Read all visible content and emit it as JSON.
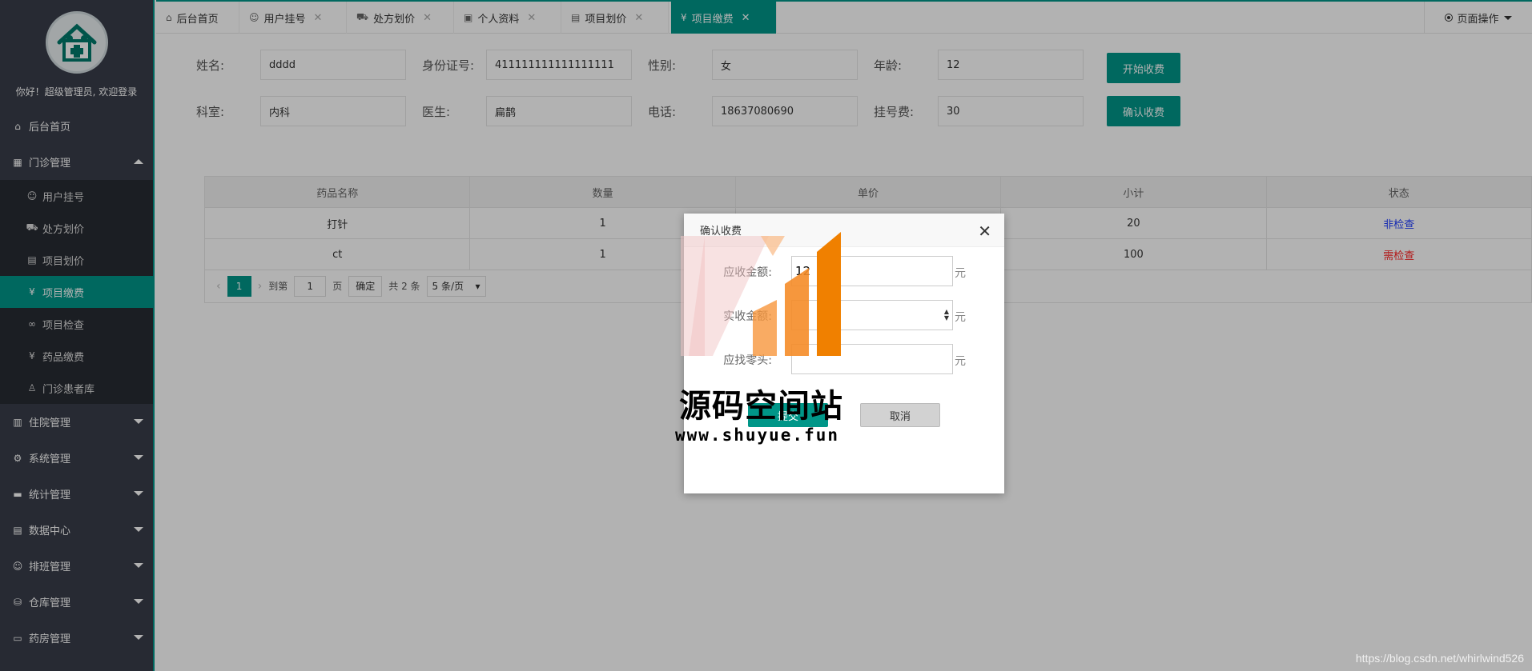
{
  "sidebar": {
    "welcome": "你好！超级管理员, 欢迎登录",
    "home": "后台首页",
    "outpatient": {
      "label": "门诊管理",
      "items": [
        "用户挂号",
        "处方划价",
        "项目划价",
        "项目缴费",
        "项目检查",
        "药品缴费",
        "门诊患者库"
      ]
    },
    "sections": [
      "住院管理",
      "系统管理",
      "统计管理",
      "数据中心",
      "排班管理",
      "仓库管理",
      "药房管理"
    ]
  },
  "tabs": [
    "后台首页",
    "用户挂号",
    "处方划价",
    "个人资料",
    "项目划价",
    "项目缴费"
  ],
  "page_operation": "页面操作",
  "form": {
    "name_label": "姓名:",
    "name_value": "dddd",
    "id_label": "身份证号:",
    "id_value": "411111111111111111",
    "gender_label": "性别:",
    "gender_value": "女",
    "age_label": "年龄:",
    "age_value": "12",
    "dept_label": "科室:",
    "dept_value": "内科",
    "doctor_label": "医生:",
    "doctor_value": "扁鹊",
    "phone_label": "电话:",
    "phone_value": "18637080690",
    "fee_label": "挂号费:",
    "fee_value": "30",
    "start_btn": "开始收费",
    "confirm_btn": "确认收费"
  },
  "table": {
    "headers": [
      "药品名称",
      "数量",
      "单价",
      "小计",
      "状态"
    ],
    "rows": [
      {
        "name": "打针",
        "qty": "1",
        "price": "",
        "subtotal": "20",
        "status": "非检查"
      },
      {
        "name": "ct",
        "qty": "1",
        "price": "",
        "subtotal": "100",
        "status": "需检查"
      }
    ]
  },
  "pager": {
    "current": "1",
    "goto": "到第",
    "page_input": "1",
    "page_unit": "页",
    "confirm": "确定",
    "total": "共 2 条",
    "per_page": "5 条/页"
  },
  "modal": {
    "title": "确认收费",
    "receivable_label": "应收金额:",
    "receivable_value": "12",
    "received_label": "实收金额:",
    "received_value": "",
    "change_label": "应找零头:",
    "change_value": "",
    "unit": "元",
    "submit": "提交",
    "cancel": "取消"
  },
  "watermark": {
    "text": "源码空间站",
    "url": "www.shuyue.fun"
  },
  "csdn_watermark": "https://blog.csdn.net/whirlwind526"
}
